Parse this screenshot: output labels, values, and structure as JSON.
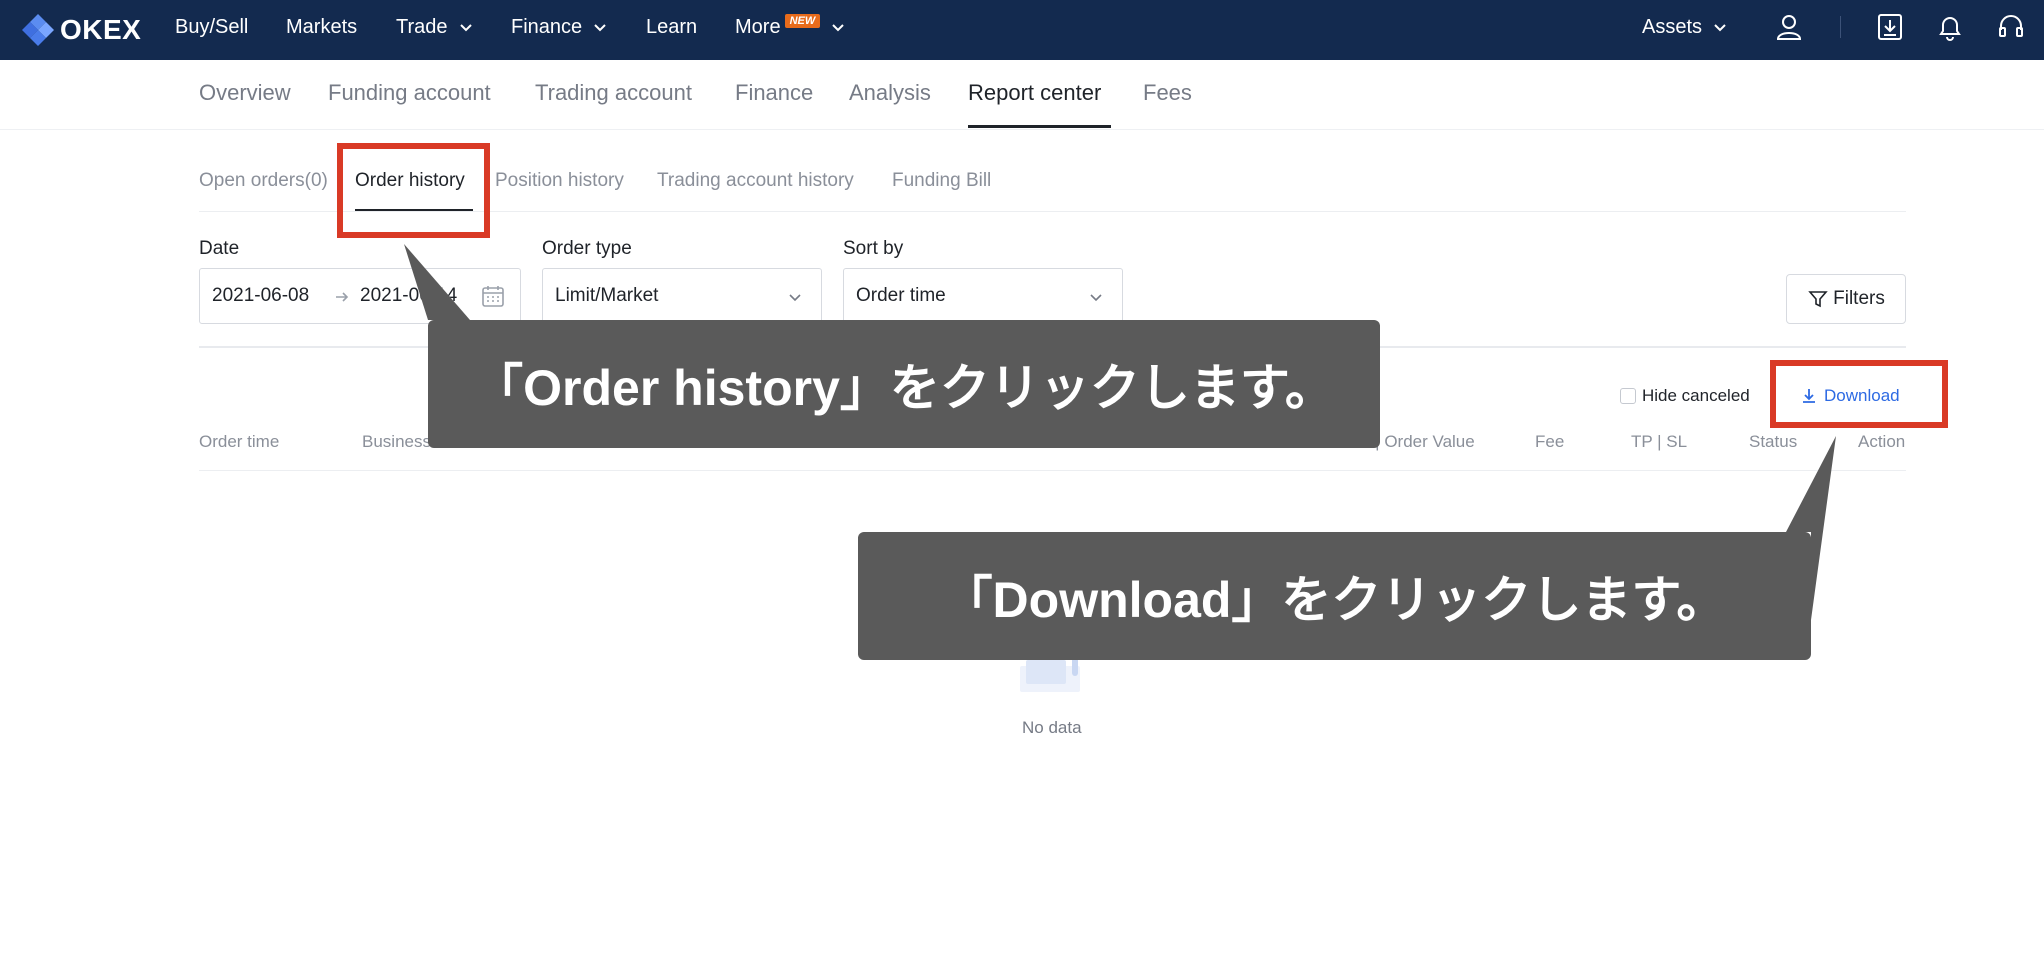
{
  "topnav": {
    "logo": "OKEX",
    "items": [
      {
        "label": "Buy/Sell",
        "has_dropdown": false
      },
      {
        "label": "Markets",
        "has_dropdown": false
      },
      {
        "label": "Trade",
        "has_dropdown": true
      },
      {
        "label": "Finance",
        "has_dropdown": true
      },
      {
        "label": "Learn",
        "has_dropdown": false
      },
      {
        "label": "More",
        "has_dropdown": true,
        "badge": "NEW"
      }
    ],
    "assets_label": "Assets",
    "icons": [
      "user-icon",
      "download-app-icon",
      "bell-icon",
      "headset-icon"
    ]
  },
  "subnav": {
    "items": [
      "Overview",
      "Funding account",
      "Trading account",
      "Finance",
      "Analysis",
      "Report center",
      "Fees"
    ],
    "active": "Report center"
  },
  "tabs": {
    "items": [
      "Open orders(0)",
      "Order history",
      "Position history",
      "Trading account history",
      "Funding Bill"
    ],
    "active": "Order history"
  },
  "filters": {
    "date_label": "Date",
    "date_start": "2021-06-08",
    "date_end": "2021-06-14",
    "order_type_label": "Order type",
    "order_type_value": "Limit/Market",
    "sort_by_label": "Sort by",
    "sort_by_value": "Order time",
    "filters_button": "Filters"
  },
  "table": {
    "hide_canceled_label": "Hide canceled",
    "hide_canceled_checked": false,
    "download_label": "Download",
    "columns": [
      "Order time",
      "Business",
      "d | Order Value",
      "Fee",
      "TP | SL",
      "Status",
      "Action"
    ],
    "empty_text": "No data"
  },
  "annotations": {
    "callout_1": "「Order history」をクリックします。",
    "callout_2": "「Download」をクリックします。",
    "highlight_color": "#d93a26",
    "callout_bg": "#5a5a5a"
  },
  "colors": {
    "nav_bg": "#132a4f",
    "link_blue": "#2d6ae3",
    "badge_orange": "#e86b1b"
  }
}
